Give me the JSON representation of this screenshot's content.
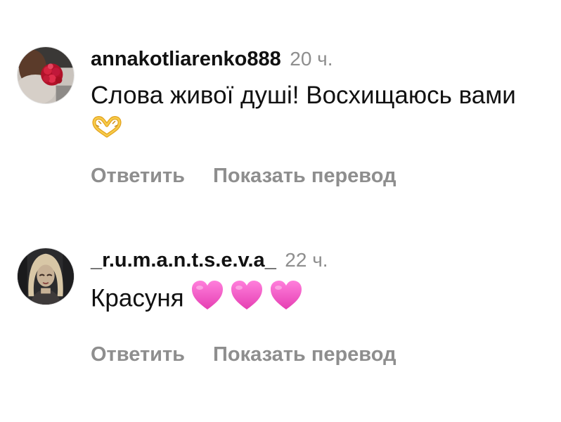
{
  "comments": [
    {
      "username": "annakotliarenko888",
      "time": "20 ч.",
      "text": "Слова живої душі! Восхищаюсь вами",
      "emoji": [
        "heart-hands-icon"
      ],
      "reply_label": "Ответить",
      "translate_label": "Показать перевод"
    },
    {
      "username": "_r.u.m.a.n.t.s.e.v.a_",
      "time": "22 ч.",
      "text": "Красуня",
      "emoji": [
        "pink-heart-icon",
        "pink-heart-icon",
        "pink-heart-icon"
      ],
      "reply_label": "Ответить",
      "translate_label": "Показать перевод"
    }
  ],
  "colors": {
    "text": "#111111",
    "secondary": "#8e8e8e",
    "heart_pink": "#f24fc3",
    "heart_hands": "#f2b62b"
  }
}
